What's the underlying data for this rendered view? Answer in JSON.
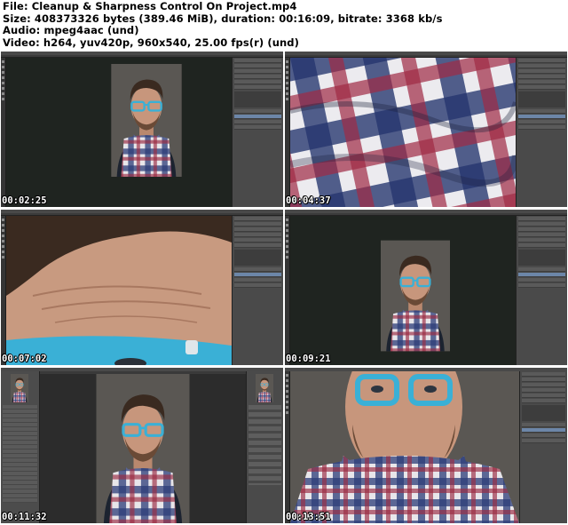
{
  "header": {
    "line1": "File: Cleanup & Sharpness Control On Project.mp4",
    "line2": "Size: 408373326 bytes (389.46 MiB), duration: 00:16:09, bitrate: 3368 kb/s",
    "line3": "Audio: mpeg4aac (und)",
    "line4": "Video: h264, yuv420p, 960x540, 25.00 fps(r) (und)"
  },
  "thumbnails": [
    {
      "timestamp": "00:02:25",
      "scene": "portrait-full"
    },
    {
      "timestamp": "00:04:37",
      "scene": "scarf-closeup"
    },
    {
      "timestamp": "00:07:02",
      "scene": "forehead-closeup"
    },
    {
      "timestamp": "00:09:21",
      "scene": "portrait-full"
    },
    {
      "timestamp": "00:11:32",
      "scene": "portrait-with-menu"
    },
    {
      "timestamp": "00:13:51",
      "scene": "face-zoom"
    }
  ],
  "colors": {
    "glasses": "#3ab0d6",
    "skin": "#c7967c",
    "hair": "#3a2a20",
    "scarf_blue": "#2c3c78",
    "scarf_red": "#9a2a40",
    "backdrop": "#5a5753"
  }
}
